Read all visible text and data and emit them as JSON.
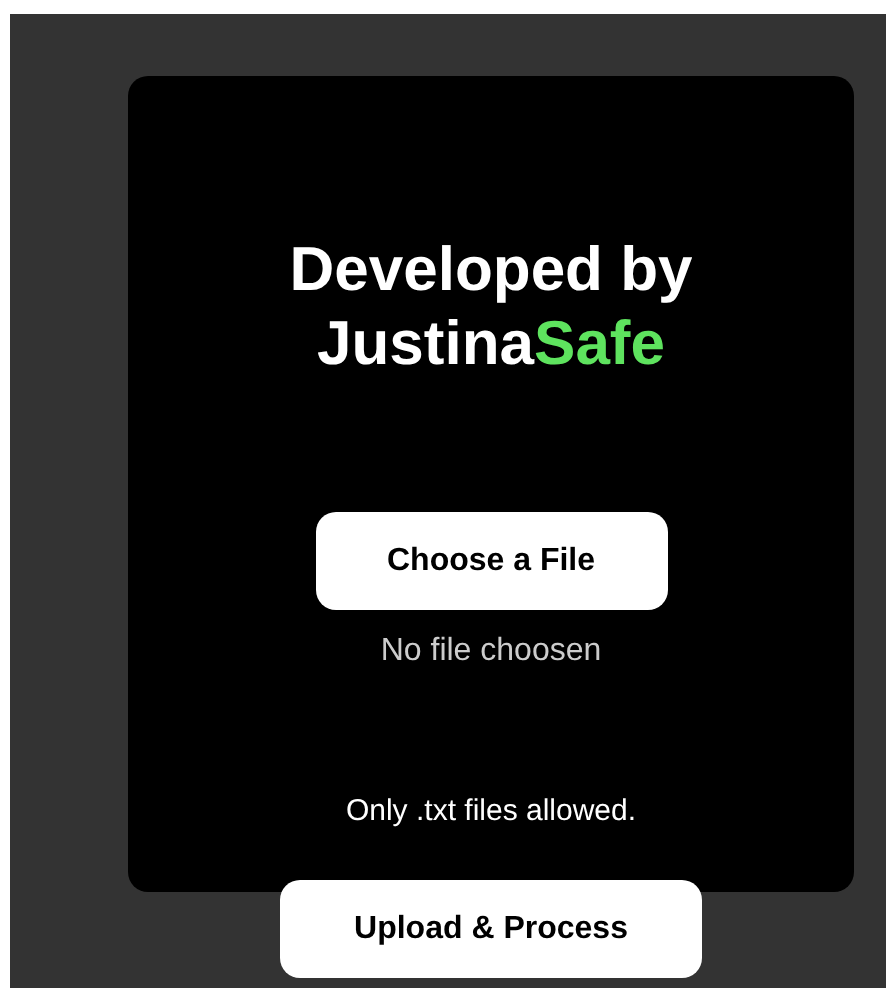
{
  "heading": {
    "text": "Developed by",
    "brand": "Justina",
    "brand_accent": "Safe"
  },
  "choose_button": "Choose a File",
  "file_status": "No file choosen",
  "hint": "Only .txt files allowed.",
  "upload_button": "Upload & Process"
}
